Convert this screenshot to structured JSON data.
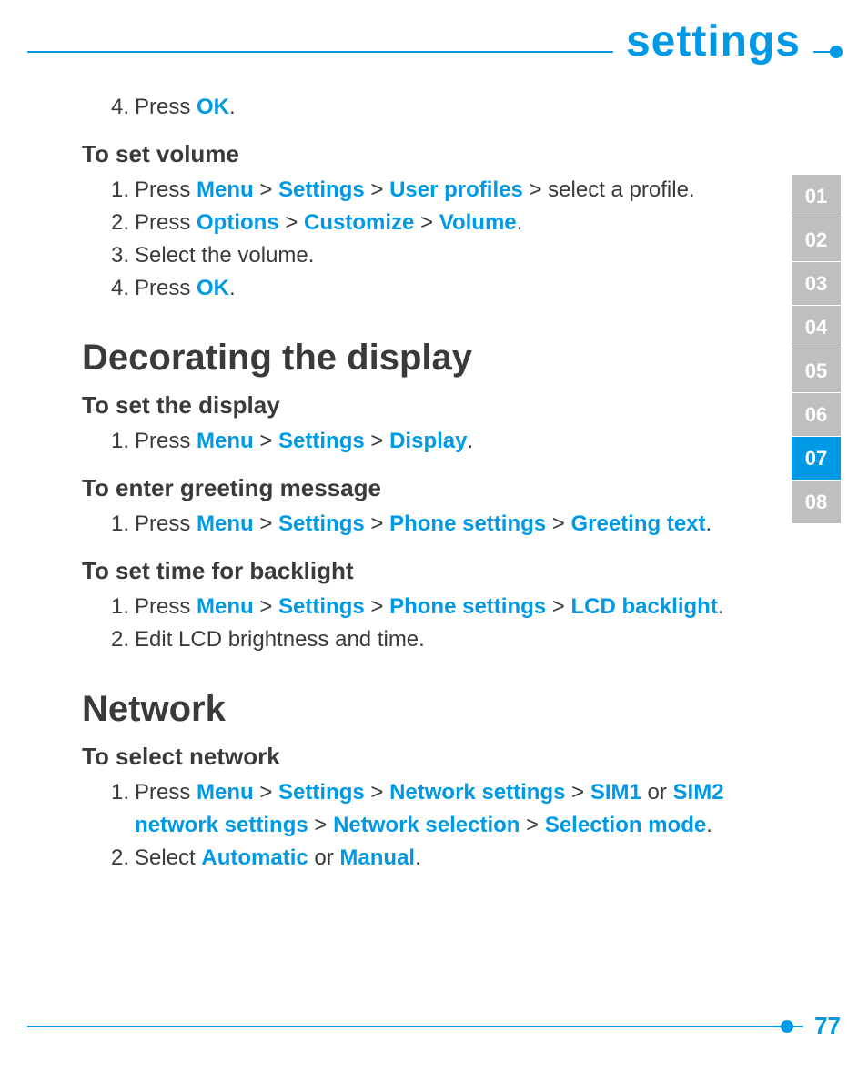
{
  "colors": {
    "accent": "#0099e5",
    "text": "#3a3a3a",
    "tab_inactive": "#bfbfbf"
  },
  "header": {
    "title": "settings"
  },
  "page_number": "77",
  "side_tabs": {
    "items": [
      "01",
      "02",
      "03",
      "04",
      "05",
      "06",
      "07",
      "08"
    ],
    "active_index": 6
  },
  "content": {
    "intro_steps": [
      {
        "n": "4.",
        "parts": [
          {
            "t": "Press "
          },
          {
            "t": "OK",
            "hl": true
          },
          {
            "t": "."
          }
        ]
      }
    ],
    "blocks": [
      {
        "sub": "To set volume",
        "steps": [
          {
            "n": "1.",
            "parts": [
              {
                "t": "Press "
              },
              {
                "t": "Menu",
                "hl": true
              },
              {
                "t": " > "
              },
              {
                "t": "Settings",
                "hl": true
              },
              {
                "t": " > "
              },
              {
                "t": "User profiles",
                "hl": true
              },
              {
                "t": " > select a profile."
              }
            ]
          },
          {
            "n": "2.",
            "parts": [
              {
                "t": "Press "
              },
              {
                "t": "Options",
                "hl": true
              },
              {
                "t": " > "
              },
              {
                "t": "Customize",
                "hl": true
              },
              {
                "t": " > "
              },
              {
                "t": "Volume",
                "hl": true
              },
              {
                "t": "."
              }
            ]
          },
          {
            "n": "3.",
            "parts": [
              {
                "t": "Select the volume."
              }
            ]
          },
          {
            "n": "4.",
            "parts": [
              {
                "t": "Press "
              },
              {
                "t": "OK",
                "hl": true
              },
              {
                "t": "."
              }
            ]
          }
        ]
      },
      {
        "section": "Decorating the display",
        "groups": [
          {
            "sub": "To set the display",
            "steps": [
              {
                "n": "1.",
                "parts": [
                  {
                    "t": "Press "
                  },
                  {
                    "t": "Menu",
                    "hl": true
                  },
                  {
                    "t": " > "
                  },
                  {
                    "t": "Settings",
                    "hl": true
                  },
                  {
                    "t": " > "
                  },
                  {
                    "t": "Display",
                    "hl": true
                  },
                  {
                    "t": "."
                  }
                ]
              }
            ]
          },
          {
            "sub": "To enter greeting message",
            "steps": [
              {
                "n": "1.",
                "parts": [
                  {
                    "t": "Press "
                  },
                  {
                    "t": "Menu",
                    "hl": true
                  },
                  {
                    "t": " > "
                  },
                  {
                    "t": "Settings",
                    "hl": true
                  },
                  {
                    "t": " > "
                  },
                  {
                    "t": "Phone settings",
                    "hl": true
                  },
                  {
                    "t": " > "
                  },
                  {
                    "t": "Greeting text",
                    "hl": true
                  },
                  {
                    "t": "."
                  }
                ]
              }
            ]
          },
          {
            "sub": "To set time for backlight",
            "steps": [
              {
                "n": "1.",
                "parts": [
                  {
                    "t": "Press "
                  },
                  {
                    "t": "Menu",
                    "hl": true
                  },
                  {
                    "t": " > "
                  },
                  {
                    "t": "Settings",
                    "hl": true
                  },
                  {
                    "t": " > "
                  },
                  {
                    "t": "Phone settings",
                    "hl": true
                  },
                  {
                    "t": " > "
                  },
                  {
                    "t": "LCD backlight",
                    "hl": true
                  },
                  {
                    "t": "."
                  }
                ]
              },
              {
                "n": "2.",
                "parts": [
                  {
                    "t": "Edit LCD brightness and time."
                  }
                ]
              }
            ]
          }
        ]
      },
      {
        "section": "Network",
        "groups": [
          {
            "sub": "To select network",
            "steps": [
              {
                "n": "1.",
                "parts": [
                  {
                    "t": "Press "
                  },
                  {
                    "t": "Menu",
                    "hl": true
                  },
                  {
                    "t": " > "
                  },
                  {
                    "t": "Settings",
                    "hl": true
                  },
                  {
                    "t": " > "
                  },
                  {
                    "t": "Network settings",
                    "hl": true
                  },
                  {
                    "t": " > "
                  },
                  {
                    "t": "SIM1",
                    "hl": true
                  },
                  {
                    "t": " or "
                  },
                  {
                    "t": "SIM2 network settings",
                    "hl": true
                  },
                  {
                    "t": " > "
                  },
                  {
                    "t": "Network selection",
                    "hl": true
                  },
                  {
                    "t": " > "
                  },
                  {
                    "t": "Selection mode",
                    "hl": true
                  },
                  {
                    "t": "."
                  }
                ]
              },
              {
                "n": "2.",
                "parts": [
                  {
                    "t": "Select "
                  },
                  {
                    "t": "Automatic",
                    "hl": true
                  },
                  {
                    "t": " or "
                  },
                  {
                    "t": "Manual",
                    "hl": true
                  },
                  {
                    "t": "."
                  }
                ]
              }
            ]
          }
        ]
      }
    ]
  }
}
